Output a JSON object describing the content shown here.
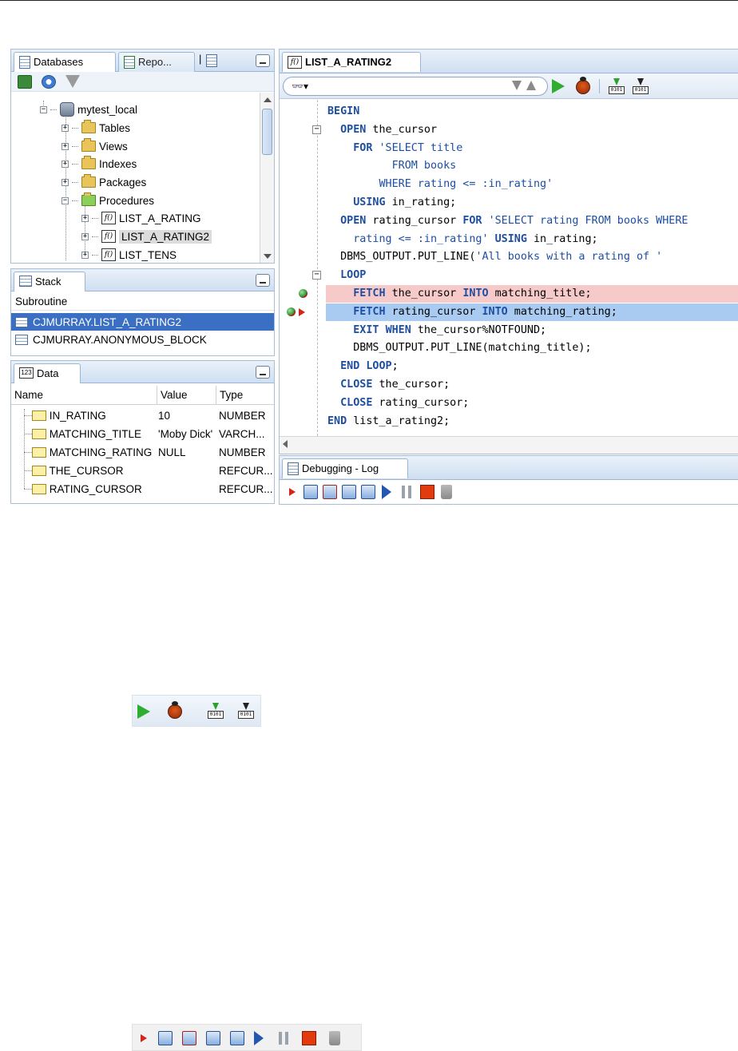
{
  "databases_panel": {
    "tabs": [
      {
        "label": "Databases",
        "icon": "databases-icon"
      },
      {
        "label": "Repo...",
        "icon": "reports-icon"
      }
    ],
    "toolbar": [
      "add-connection-icon",
      "refresh-icon",
      "filter-icon"
    ],
    "tree": [
      {
        "label": "mytest_local",
        "icon": "database-connection-icon",
        "expanded": true
      },
      {
        "label": "Tables",
        "icon": "folder-icon",
        "expanded": false
      },
      {
        "label": "Views",
        "icon": "folder-icon",
        "expanded": false
      },
      {
        "label": "Indexes",
        "icon": "folder-icon",
        "expanded": false
      },
      {
        "label": "Packages",
        "icon": "folder-icon",
        "expanded": false
      },
      {
        "label": "Procedures",
        "icon": "folder-icon",
        "expanded": true
      },
      {
        "label": "LIST_A_RATING",
        "icon": "procedure-icon",
        "expanded": false
      },
      {
        "label": "LIST_A_RATING2",
        "icon": "procedure-icon",
        "expanded": false,
        "selected": true
      },
      {
        "label": "LIST_TENS",
        "icon": "procedure-icon",
        "expanded": false
      }
    ]
  },
  "stack_panel": {
    "tab": "Stack",
    "column": "Subroutine",
    "rows": [
      {
        "label": "CJMURRAY.LIST_A_RATING2",
        "selected": true
      },
      {
        "label": "CJMURRAY.ANONYMOUS_BLOCK",
        "selected": false
      }
    ]
  },
  "data_panel": {
    "tab": "Data",
    "columns": [
      "Name",
      "Value",
      "Type"
    ],
    "rows": [
      {
        "name": "IN_RATING",
        "value": "10",
        "type": "NUMBER"
      },
      {
        "name": "MATCHING_TITLE",
        "value": "'Moby Dick'",
        "type": "VARCH..."
      },
      {
        "name": "MATCHING_RATING",
        "value": "NULL",
        "type": "NUMBER"
      },
      {
        "name": "THE_CURSOR",
        "value": "",
        "type": "REFCUR..."
      },
      {
        "name": "RATING_CURSOR",
        "value": "",
        "type": "REFCUR..."
      }
    ]
  },
  "editor": {
    "tab": "LIST_A_RATING2",
    "code": [
      [
        {
          "t": "BEGIN",
          "k": "kw"
        }
      ],
      [
        {
          "t": "  "
        },
        {
          "t": "OPEN",
          "k": "kw"
        },
        {
          "t": " the_cursor"
        }
      ],
      [
        {
          "t": "    "
        },
        {
          "t": "FOR",
          "k": "kw"
        },
        {
          "t": " "
        },
        {
          "t": "'SELECT title",
          "k": "str"
        }
      ],
      [
        {
          "t": "          FROM books",
          "k": "str"
        }
      ],
      [
        {
          "t": "        WHERE rating <= :in_rating'",
          "k": "str"
        }
      ],
      [
        {
          "t": "    "
        },
        {
          "t": "USING",
          "k": "kw"
        },
        {
          "t": " in_rating;"
        }
      ],
      [
        {
          "t": "  "
        },
        {
          "t": "OPEN",
          "k": "kw"
        },
        {
          "t": " rating_cursor "
        },
        {
          "t": "FOR",
          "k": "kw"
        },
        {
          "t": " "
        },
        {
          "t": "'SELECT rating FROM books WHERE",
          "k": "str"
        }
      ],
      [
        {
          "t": "    "
        },
        {
          "t": "rating <= :in_rating'",
          "k": "str"
        },
        {
          "t": " "
        },
        {
          "t": "USING",
          "k": "kw"
        },
        {
          "t": " in_rating;"
        }
      ],
      [
        {
          "t": "  DBMS_OUTPUT.PUT_LINE("
        },
        {
          "t": "'All books with a rating of '",
          "k": "str"
        }
      ],
      [
        {
          "t": "  "
        },
        {
          "t": "LOOP",
          "k": "kw"
        }
      ],
      [
        {
          "t": "    "
        },
        {
          "t": "FETCH",
          "k": "kw"
        },
        {
          "t": " the_cursor "
        },
        {
          "t": "INTO",
          "k": "kw"
        },
        {
          "t": " matching_title;"
        }
      ],
      [
        {
          "t": "    "
        },
        {
          "t": "FETCH",
          "k": "kw"
        },
        {
          "t": " rating_cursor "
        },
        {
          "t": "INTO",
          "k": "kw"
        },
        {
          "t": " matching_rating;"
        }
      ],
      [
        {
          "t": "    "
        },
        {
          "t": "EXIT",
          "k": "kw"
        },
        {
          "t": " "
        },
        {
          "t": "WHEN",
          "k": "kw"
        },
        {
          "t": " the_cursor%NOTFOUND;"
        }
      ],
      [
        {
          "t": "    DBMS_OUTPUT.PUT_LINE(matching_title);"
        }
      ],
      [
        {
          "t": "  "
        },
        {
          "t": "END",
          "k": "kw"
        },
        {
          "t": " "
        },
        {
          "t": "LOOP",
          "k": "kw"
        },
        {
          "t": ";"
        }
      ],
      [
        {
          "t": "  "
        },
        {
          "t": "CLOSE",
          "k": "kw"
        },
        {
          "t": " the_cursor;"
        }
      ],
      [
        {
          "t": "  "
        },
        {
          "t": "CLOSE",
          "k": "kw"
        },
        {
          "t": " rating_cursor;"
        }
      ],
      [
        {
          "t": "END",
          "k": "kw"
        },
        {
          "t": " list_a_rating2;"
        }
      ]
    ],
    "breakpoint_line": 10,
    "current_line": 11,
    "fold_lines": [
      1,
      9
    ],
    "highlight_colors": {
      "breakpoint": "#f7caca",
      "current": "#a9cbf2",
      "keyword": "#1e4ea2"
    }
  },
  "log_panel": {
    "tab": "Debugging - Log",
    "toolbar": [
      "find-execution-point-icon",
      "step-over-icon",
      "step-into-icon",
      "step-out-icon",
      "step-to-end-icon",
      "resume-icon",
      "pause-icon",
      "terminate-icon",
      "clear-icon"
    ]
  },
  "callouts": {
    "editor_run_toolbar": [
      "run-icon",
      "debug-icon",
      "compile-icon",
      "compile-debug-icon"
    ],
    "debug_toolbar": [
      "find-execution-point-icon",
      "step-over-icon",
      "step-into-icon",
      "step-out-icon",
      "step-to-end-icon",
      "resume-icon",
      "pause-icon",
      "terminate-icon",
      "clear-icon"
    ]
  }
}
